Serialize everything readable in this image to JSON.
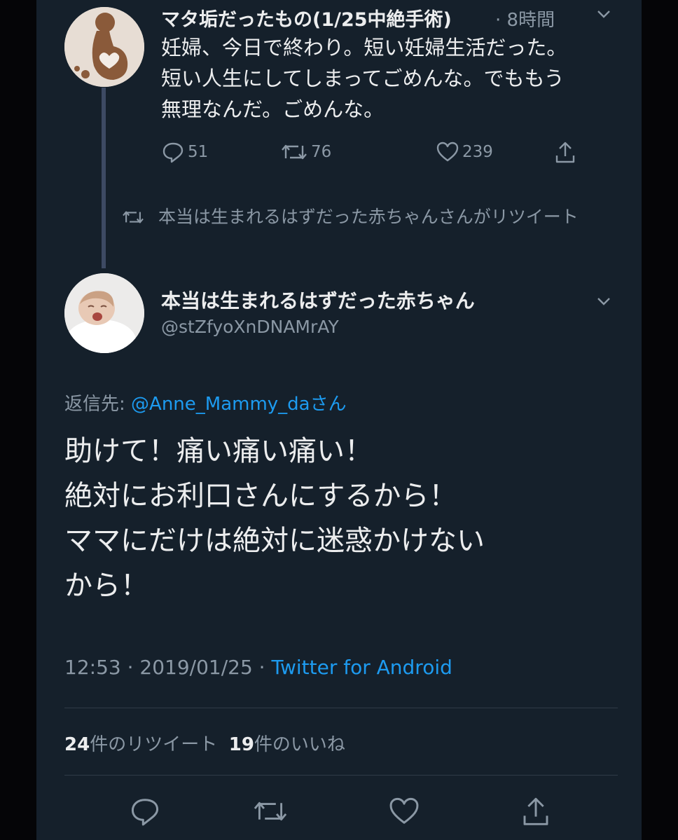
{
  "tweet1": {
    "display_name": "マタ垢だったもの(1/25中絶手術)",
    "time": "· 8時間",
    "text_lines": [
      "妊婦、今日で終わり。短い妊婦生活だった。",
      "短い人生にしてしまってごめんな。でももう",
      "無理なんだ。ごめんな。"
    ],
    "reply_count": "51",
    "retweet_count": "76",
    "like_count": "239"
  },
  "retweet_note": {
    "text": "本当は生まれるはずだった赤ちゃんさんがリツイート"
  },
  "tweet2": {
    "display_name": "本当は生まれるはずだった赤ちゃん",
    "handle": "@stZfyoXnDNAMrAY",
    "reply_to_prefix": "返信先: ",
    "reply_to_mention": "@Anne_Mammy_da",
    "reply_to_suffix": "さん",
    "text_lines": [
      "助けて！痛い痛い痛い！",
      "絶対にお利口さんにするから！",
      "ママにだけは絶対に迷惑かけない",
      "から！"
    ],
    "timestamp": "12:53 · 2019/01/25 · ",
    "client": "Twitter for Android",
    "retweet_total": "24",
    "retweet_total_label": "件のリツイート",
    "like_total": "19",
    "like_total_label": "件のいいね"
  },
  "icons": {
    "reply": "reply-icon",
    "retweet": "retweet-icon",
    "like": "heart-icon",
    "share": "share-icon",
    "more": "chevron-down-icon"
  },
  "colors": {
    "background": "#15202b",
    "link": "#1d9bf0",
    "secondary_text": "#8b98a5"
  }
}
